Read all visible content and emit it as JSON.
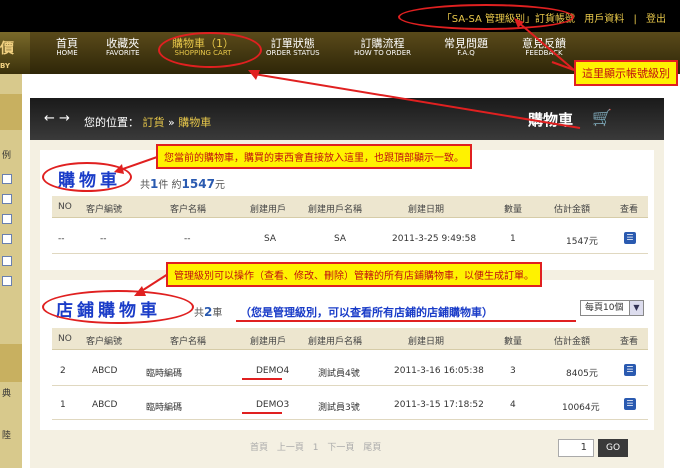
{
  "topbar": {
    "level": "「SA-SA 管理級別」訂貨帳號",
    "user_info": "用戶資料",
    "sep": "|",
    "logout": "登出"
  },
  "logo": {
    "mark": "價",
    "sub": "BY"
  },
  "nav": [
    {
      "zh": "首頁",
      "en": "HOME"
    },
    {
      "zh": "收藏夾",
      "en": "FAVORITE"
    },
    {
      "zh": "購物車（1）",
      "en": "SHOPPING CART"
    },
    {
      "zh": "訂單狀態",
      "en": "ORDER STATUS"
    },
    {
      "zh": "訂購流程",
      "en": "HOW TO ORDER"
    },
    {
      "zh": "常見問題",
      "en": "F.A.Q"
    },
    {
      "zh": "意見反饋",
      "en": "FEEDBACK"
    }
  ],
  "left_strip": [
    "例",
    "典",
    "陸"
  ],
  "breadcrumb": {
    "label": "您的位置：",
    "link": "訂貨",
    "sep": "»",
    "current": "購物車"
  },
  "page_header": "購物車",
  "annotations": {
    "account_level": "這里顯示帳號級別",
    "my_cart": "您當前的購物車，購買的東西會直接放入這里，也跟頂部顯示一致。",
    "store_carts": "管理級別可以操作（查看、修改、刪除）管轄的所有店鋪購物車，以便生成訂單。",
    "admin_note": "（您是管理級別，可以查看所有店鋪的店鋪購物車）"
  },
  "my_cart": {
    "title": "購物車",
    "summary_pre": "共",
    "count": "1",
    "count_unit": "件",
    "amount_pre": "約",
    "amount": "1547",
    "amount_unit": "元",
    "headers": [
      "NO",
      "客户編號",
      "客户名稱",
      "創建用戶",
      "創建用戶名稱",
      "創建日期",
      "數量",
      "估計金額",
      "查看"
    ],
    "rows": [
      [
        "--",
        "--",
        "--",
        "SA",
        "SA",
        "2011-3-25 9:49:58",
        "1",
        "1547元"
      ]
    ]
  },
  "store_cart": {
    "title": "店鋪購物車",
    "summary_pre": "共",
    "count": "2",
    "count_unit": "車",
    "per_page": "每頁10個",
    "headers": [
      "NO",
      "客户編號",
      "客户名稱",
      "創建用戶",
      "創建用戶名稱",
      "創建日期",
      "數量",
      "估計金額",
      "查看"
    ],
    "rows": [
      [
        "2",
        "ABCD",
        "臨時編碼",
        "DEMO4",
        "測試員4號",
        "2011-3-16 16:05:38",
        "3",
        "8405元"
      ],
      [
        "1",
        "ABCD",
        "臨時編碼",
        "DEMO3",
        "測試員3號",
        "2011-3-15 17:18:52",
        "4",
        "10064元"
      ]
    ]
  },
  "pager": {
    "first": "首頁",
    "prev": "上一頁",
    "page": "1",
    "next": "下一頁",
    "last": "尾頁",
    "input": "1",
    "go": "GO"
  },
  "colors": {
    "accent": "#e8c84a",
    "annotation_bg": "#fff200",
    "annotation_border": "#e02020",
    "title_blue": "#1a3cc8"
  }
}
